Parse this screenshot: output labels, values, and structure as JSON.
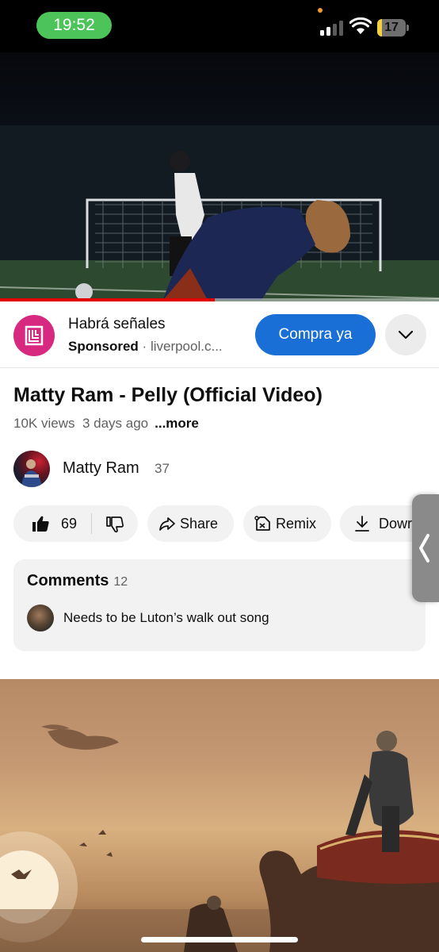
{
  "status_bar": {
    "time": "19:52",
    "battery_level": "17",
    "battery_fraction": 0.17,
    "signal_bars_active": 2,
    "colors": {
      "time_pill": "#4cc45a",
      "battery_fill": "#f4d03f",
      "privacy_dot": "#f39a2b"
    }
  },
  "player": {
    "progress_fraction": 0.49,
    "progress_color": "#e00000"
  },
  "ad": {
    "advertiser": "Habrá señales",
    "sponsored_label": "Sponsored",
    "separator": "·",
    "domain": "liverpool.c...",
    "cta_label": "Compra ya",
    "cta_color": "#1a6fd6",
    "logo_color": "#d6297f",
    "expand_icon": "chevron-down-icon"
  },
  "video": {
    "title": "Matty Ram - Pelly (Official Video)",
    "views": "10K views",
    "age": "3 days ago",
    "more_label": "...more"
  },
  "channel": {
    "name": "Matty Ram",
    "subscribers": "37"
  },
  "actions": {
    "like_count": "69",
    "like_icon": "thumbs-up-icon",
    "dislike_icon": "thumbs-down-icon",
    "share_label": "Share",
    "share_icon": "share-arrow-icon",
    "remix_label": "Remix",
    "remix_icon": "remix-icon",
    "download_label": "Dowr",
    "download_icon": "download-icon"
  },
  "comments": {
    "heading": "Comments",
    "count": "12",
    "top_comment": "Needs to be Luton’s walk out song"
  },
  "side_handle": {
    "icon": "chevron-left-icon"
  }
}
